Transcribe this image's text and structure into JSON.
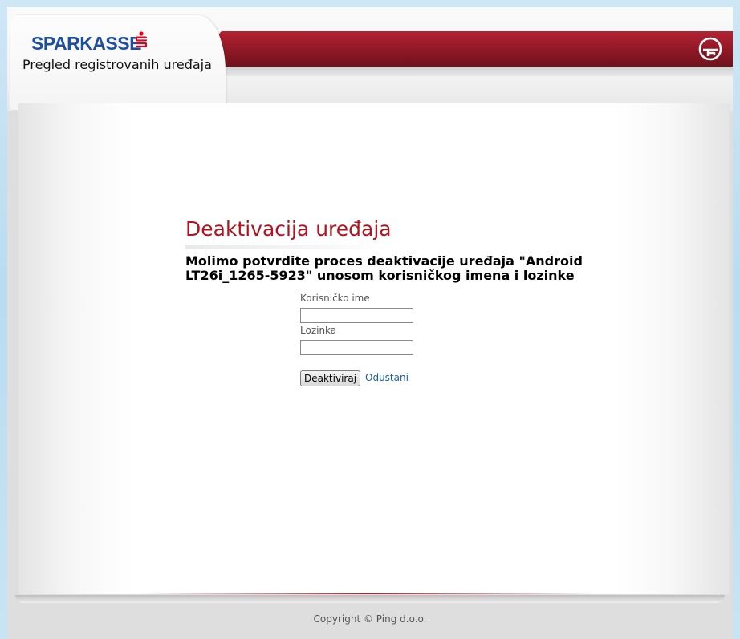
{
  "header": {
    "brand": "SPARKASSE",
    "app_title": "Pregled registrovanih uređaja",
    "colors": {
      "brand_blue": "#1f4e9c",
      "accent_red": "#b0151e"
    }
  },
  "main": {
    "title": "Deaktivacija uređaja",
    "message": "Molimo potvrdite proces deaktivacije uređaja \"Android LT26i_1265-5923\" unosom korisničkog imena i lozinke",
    "form": {
      "username_label": "Korisničko ime",
      "username_value": "",
      "password_label": "Lozinka",
      "password_value": "",
      "submit_label": "Deaktiviraj",
      "cancel_label": "Odustani"
    }
  },
  "footer": {
    "copyright": "Copyright © Ping d.o.o."
  }
}
